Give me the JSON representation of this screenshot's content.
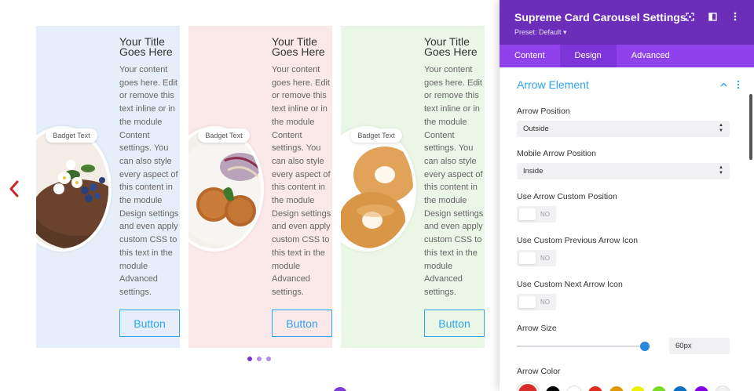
{
  "carousel": {
    "prev_icon": "chevron-left-icon",
    "cards": [
      {
        "title": "Your Title Goes Here",
        "body": "Your content goes here. Edit or remove this text inline or in the module Content settings. You can also style every aspect of this content in the module Design settings and even apply custom CSS to this text in the module Advanced settings.",
        "badge": "Badget Text",
        "button": "Button",
        "bg": "#e6eef9",
        "image": "chocolate-cake-with-blueberries-and-flowers"
      },
      {
        "title": "Your Title Goes Here",
        "body": "Your content goes here. Edit or remove this text inline or in the module Content settings. You can also style every aspect of this content in the module Design settings and even apply custom CSS to this text in the module Advanced settings.",
        "badge": "Badget Text",
        "button": "Button",
        "bg": "#fbe8e8",
        "image": "veggie-patties-with-slaw"
      },
      {
        "title": "Your Title Goes Here",
        "body": "Your content goes here. Edit or remove this text inline or in the module Content settings. You can also style every aspect of this content in the module Design settings and even apply custom CSS to this text in the module Advanced settings.",
        "badge": "Badget Text",
        "button": "Button",
        "bg": "#eaf6e6",
        "image": "bagels"
      }
    ],
    "pagination": {
      "count": 3,
      "active": 0
    },
    "accent": "#2ea3f2"
  },
  "panel": {
    "title": "Supreme Card Carousel Settings",
    "preset": "Preset: Default ▾",
    "header_icons": [
      "focus-icon",
      "split-view-icon",
      "more-vertical-icon"
    ],
    "tabs": [
      {
        "label": "Content",
        "active": false
      },
      {
        "label": "Design",
        "active": true
      },
      {
        "label": "Advanced",
        "active": false
      }
    ],
    "section": {
      "title": "Arrow Element",
      "icons": [
        "chevron-up-icon",
        "more-vertical-icon"
      ]
    },
    "fields": {
      "arrow_position": {
        "label": "Arrow Position",
        "value": "Outside"
      },
      "mobile_arrow_position": {
        "label": "Mobile Arrow Position",
        "value": "Inside"
      },
      "custom_position": {
        "label": "Use Arrow Custom Position",
        "state": "NO"
      },
      "custom_prev_icon": {
        "label": "Use Custom Previous Arrow Icon",
        "state": "NO"
      },
      "custom_next_icon": {
        "label": "Use Custom Next Arrow Icon",
        "state": "NO"
      },
      "arrow_size": {
        "label": "Arrow Size",
        "value": "60px",
        "fraction": 0.97
      },
      "arrow_color": {
        "label": "Arrow Color",
        "selected": "#d92d2d",
        "palette": [
          "#000000",
          "#ffffff",
          "#e02b20",
          "#e09900",
          "#edf000",
          "#7cda24",
          "#0c71c3",
          "#8300e9",
          "#f0f0f0"
        ]
      }
    },
    "brand_colors": {
      "header": "#6c2eb9",
      "tabs": "#8f42ec",
      "active_tab": "#7d35d9"
    }
  }
}
